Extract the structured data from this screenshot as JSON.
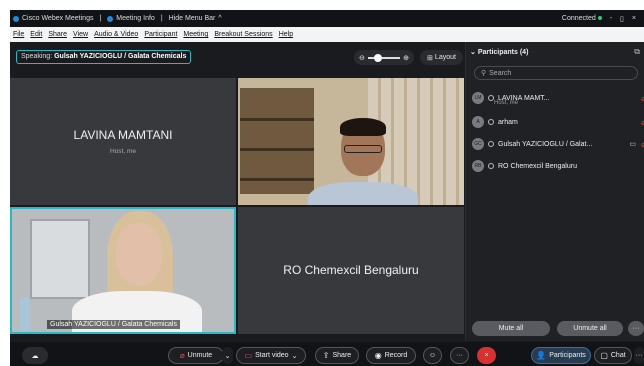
{
  "titlebar": {
    "app": "Cisco Webex Meetings",
    "separator": "|",
    "meeting_info": "Meeting Info",
    "separator2": "|",
    "hide_menu": "Hide Menu Bar",
    "hide_menu_chevron": "^",
    "connected": "Connected",
    "minimize": "-",
    "maximize": "▯",
    "close": "×"
  },
  "menu": [
    "File",
    "Edit",
    "Share",
    "View",
    "Audio & Video",
    "Participant",
    "Meeting",
    "Breakout Sessions",
    "Help"
  ],
  "stage": {
    "speaking_label": "Speaking:",
    "speaking_name": "Gulsah YAZICIOGLU / Galata Chemicals",
    "zoom_minus": "⊖",
    "zoom_plus": "⊕",
    "layout_label": "Layout"
  },
  "tiles": {
    "host_name": "LAVINA MAMTANI",
    "host_sub": "Host, me",
    "gulsah_label": "Gulsah YAZICIOGLU / Galata Chemicals",
    "ro_name": "RO Chemexcil Bengaluru"
  },
  "participants": {
    "title": "Participants (4)",
    "search_placeholder": "Search",
    "list": [
      {
        "initials": "LM",
        "name": "LAVINA MAMT...",
        "sub": "Host, me"
      },
      {
        "initials": "A",
        "name": "arham",
        "sub": ""
      },
      {
        "initials": "GC",
        "name": "Gulsah YAZICIOGLU / Galat...",
        "sub": ""
      },
      {
        "initials": "RB",
        "name": "RO Chemexcil Bengaluru",
        "sub": ""
      }
    ],
    "mute_all": "Mute all",
    "unmute_all": "Unmute all",
    "more": "···"
  },
  "controls": {
    "unmute": "Unmute",
    "start_video": "Start video",
    "share": "Share",
    "record": "Record",
    "reactions": "☺",
    "more": "···",
    "end": "×",
    "participants": "Participants",
    "chat": "Chat",
    "more_right": "···"
  },
  "colors": {
    "accent": "#2bb7c5",
    "end": "#d93030",
    "connected": "#2ecc71"
  }
}
